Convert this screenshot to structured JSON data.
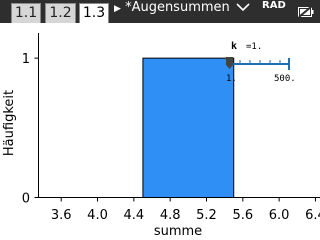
{
  "tabs": [
    {
      "label": "1.1",
      "active": false
    },
    {
      "label": "1.2",
      "active": false
    },
    {
      "label": "1.3",
      "active": true
    }
  ],
  "document_title": "*Augensummen",
  "status": {
    "angle_mode": "RAD"
  },
  "colors": {
    "bar": "#2f8ff5",
    "slider": "#1f6fb5",
    "topbar": "#2e2e2e"
  },
  "slider": {
    "label": "k",
    "value_text": "=1.",
    "min": "1.",
    "max": "500."
  },
  "chart_data": {
    "type": "bar",
    "bins": [
      {
        "x_start": 4.5,
        "x_end": 5.5,
        "value": 1
      }
    ],
    "xlim": [
      3.35,
      6.45
    ],
    "ylim": [
      0,
      1.08
    ],
    "x_ticks": [
      "3.6",
      "4.0",
      "4.4",
      "4.8",
      "5.2",
      "5.6",
      "6.0",
      "6.4"
    ],
    "y_ticks": [
      "0",
      "1"
    ],
    "xlabel": "summe",
    "ylabel": "Häufigkeit",
    "grid": false
  }
}
